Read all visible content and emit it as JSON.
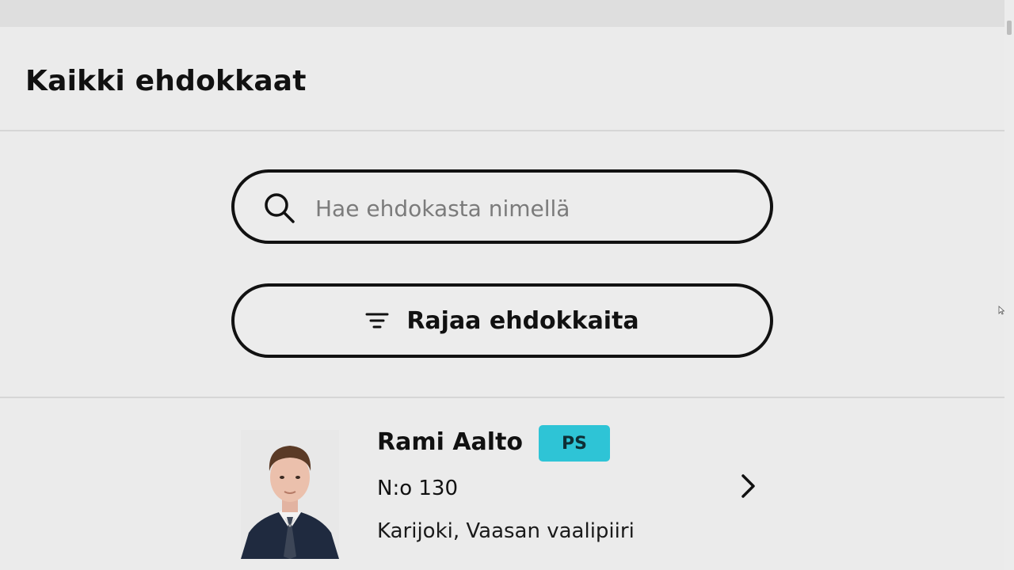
{
  "page": {
    "title": "Kaikki ehdokkaat"
  },
  "search": {
    "placeholder": "Hae ehdokasta nimellä",
    "value": ""
  },
  "filter": {
    "label": "Rajaa ehdokkaita"
  },
  "candidates": [
    {
      "name": "Rami Aalto",
      "party": "PS",
      "number": "N:o 130",
      "location": "Karijoki, Vaasan vaalipiiri"
    }
  ],
  "colors": {
    "background": "#ebebeb",
    "border": "#111111",
    "party_badge": "#2ec4d6",
    "placeholder": "#7b7b7b"
  }
}
